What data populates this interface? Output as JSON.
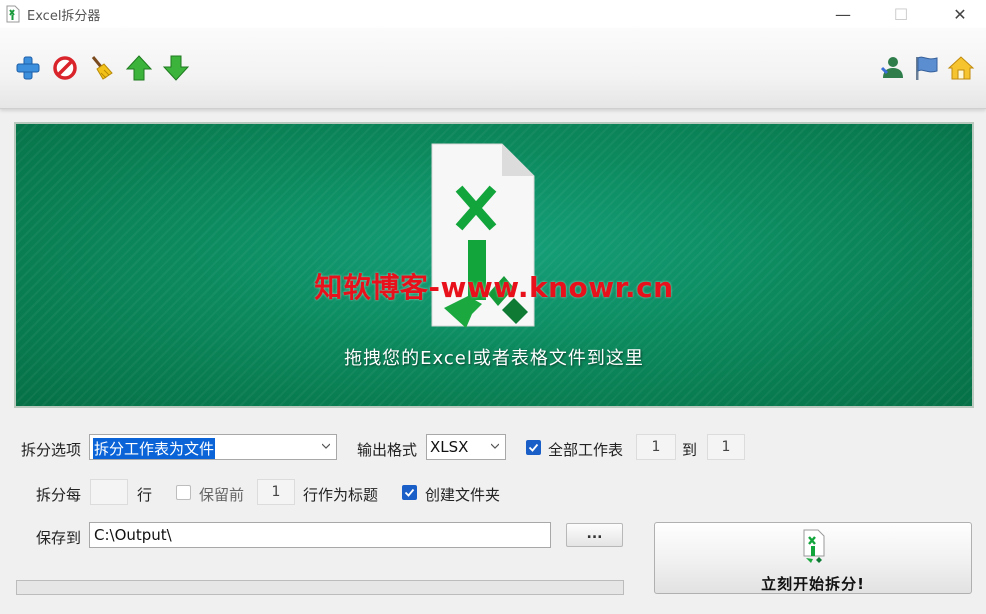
{
  "window": {
    "title": "Excel拆分器",
    "controls": {
      "minimize": "—",
      "maximize": "☐",
      "close": "✕"
    }
  },
  "toolbar": {
    "left_icons": [
      "add-icon",
      "delete-icon",
      "clear-broom-icon",
      "move-up-icon",
      "move-down-icon"
    ],
    "right_icons": [
      "user-icon",
      "flag-icon",
      "home-icon"
    ]
  },
  "dropzone": {
    "watermark": "知软博客-www.knowr.cn",
    "hint": "拖拽您的Excel或者表格文件到这里"
  },
  "options": {
    "split_option_label": "拆分选项",
    "split_option_value": "拆分工作表为文件",
    "output_format_label": "输出格式",
    "output_format_value": "XLSX",
    "all_sheets_label": "全部工作表",
    "all_sheets_checked": true,
    "sheet_from": "1",
    "to_label": "到",
    "sheet_to": "1",
    "split_every_label": "拆分每",
    "split_every_value": "",
    "rows_label": "行",
    "keep_first_label": "保留前",
    "keep_first_checked": false,
    "keep_first_value": "1",
    "as_header_label": "行作为标题",
    "create_folder_label": "创建文件夹",
    "create_folder_checked": true,
    "save_to_label": "保存到",
    "save_to_value": "C:\\Output\\",
    "browse_label": "..."
  },
  "progress": {
    "value": 0
  },
  "start_button": {
    "label": "立刻开始拆分!"
  },
  "colors": {
    "accent": "#1a5fc7",
    "dropzone_green": "#0c8a5e",
    "watermark_red": "#e8101a",
    "excel_green": "#12a53c"
  }
}
